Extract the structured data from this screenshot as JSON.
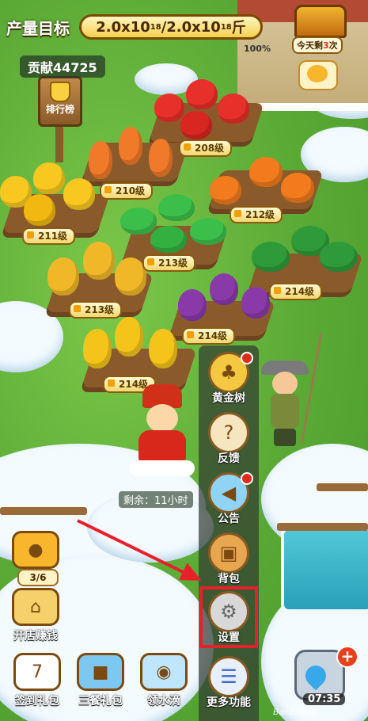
{
  "hud": {
    "goal_label": "产量目标",
    "goal_current_base": "2.0x10",
    "goal_current_exp": "18",
    "goal_sep": "/",
    "goal_total_base": "2.0x10",
    "goal_total_exp": "18",
    "goal_unit": "斤",
    "goal_percent": "100%",
    "contribution": "贡献44725"
  },
  "chest": {
    "label_prefix": "今天剩",
    "remaining": "3",
    "label_suffix": "次"
  },
  "leaderboard": {
    "label": "排行榜"
  },
  "plots": [
    {
      "level": "208级"
    },
    {
      "level": "210级"
    },
    {
      "level": "212级"
    },
    {
      "level": "211级"
    },
    {
      "level": "213级"
    },
    {
      "level": "214级"
    },
    {
      "level": "213级"
    },
    {
      "level": "214级"
    },
    {
      "level": "214级"
    }
  ],
  "remaining_time": "剩余：11小时",
  "side_menu": [
    {
      "label": "黄金树",
      "icon": "golden-tree-icon",
      "badge": true
    },
    {
      "label": "反馈",
      "icon": "feedback-icon",
      "badge": false
    },
    {
      "label": "公告",
      "icon": "megaphone-icon",
      "badge": true
    },
    {
      "label": "背包",
      "icon": "backpack-icon",
      "badge": false
    },
    {
      "label": "设置",
      "icon": "gear-icon",
      "badge": false
    },
    {
      "label": "更多功能",
      "icon": "more-list-icon",
      "badge": false
    }
  ],
  "left_buttons": {
    "progress": "3/6",
    "shop_label": "开店赚钱",
    "checkin_label": "签到礼包",
    "checkin_day": "7",
    "meal_label": "三餐礼包",
    "water_label": "领水滴"
  },
  "water": {
    "timer": "07:35"
  },
  "colors": {
    "highlight": "#e8202a",
    "gold": "#f4d050",
    "badge": "#e02a1a"
  },
  "watermark": "Baidu经验"
}
